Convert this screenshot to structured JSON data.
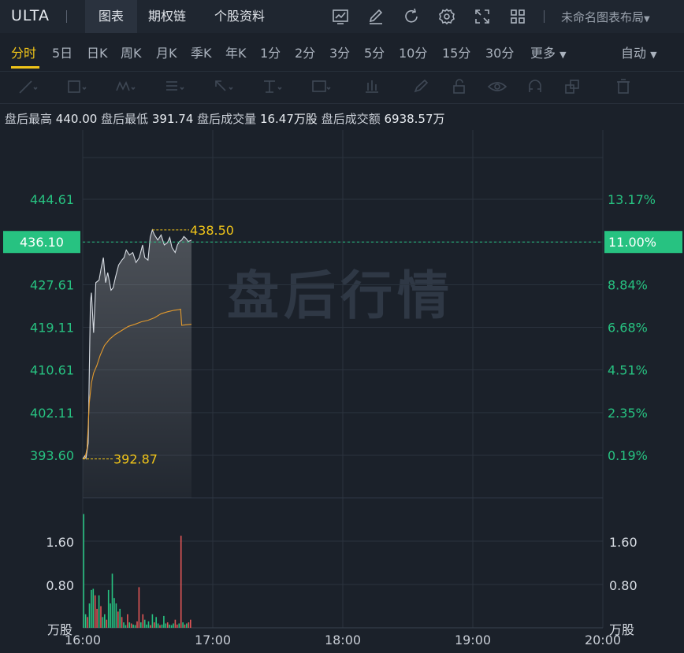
{
  "header": {
    "ticker": "ULTA",
    "tabs": [
      {
        "label": "图表",
        "active": true
      },
      {
        "label": "期权链",
        "active": false
      },
      {
        "label": "个股资料",
        "active": false
      }
    ],
    "layout_label": "未命名图表布局",
    "icons": [
      "chart-icon",
      "edit-icon",
      "refresh-icon",
      "settings-icon",
      "fullscreen-icon",
      "grid-icon"
    ]
  },
  "periods": [
    {
      "label": "分时",
      "active": true
    },
    {
      "label": "5日"
    },
    {
      "label": "日K"
    },
    {
      "label": "周K"
    },
    {
      "label": "月K"
    },
    {
      "label": "季K"
    },
    {
      "label": "年K"
    },
    {
      "label": "1分"
    },
    {
      "label": "2分"
    },
    {
      "label": "3分"
    },
    {
      "label": "5分"
    },
    {
      "label": "10分"
    },
    {
      "label": "15分"
    },
    {
      "label": "30分"
    },
    {
      "label": "更多"
    }
  ],
  "auto_label": "自动",
  "stats": {
    "high_label": "盘后最高",
    "high": "440.00",
    "low_label": "盘后最低",
    "low": "391.74",
    "vol_label": "盘后成交量",
    "vol": "16.47万股",
    "amt_label": "盘后成交额",
    "amt": "6938.57万"
  },
  "watermark": "盘后行情",
  "colors": {
    "up": "#27c281",
    "down": "#e05555",
    "accent": "#f0c419",
    "price_line": "#d8dde4",
    "avg_line": "#e39a2d"
  },
  "chart_data": {
    "type": "line",
    "x_ticks": [
      "16:00",
      "17:00",
      "18:00",
      "19:00",
      "20:00"
    ],
    "price_ticks": [
      "444.61",
      "436.10",
      "427.61",
      "419.11",
      "410.61",
      "402.11",
      "393.60"
    ],
    "pct_ticks": [
      "13.17%",
      "11.00%",
      "8.84%",
      "6.68%",
      "4.51%",
      "2.35%",
      "0.19%"
    ],
    "ylim": [
      388,
      452
    ],
    "current_price": "436.10",
    "current_pct": "11.00%",
    "max_label": "438.50",
    "min_label": "392.87",
    "price": [
      [
        0.0,
        392.9
      ],
      [
        0.02,
        393.5
      ],
      [
        0.03,
        393.0
      ],
      [
        0.05,
        396.0
      ],
      [
        0.07,
        424.0
      ],
      [
        0.08,
        426.0
      ],
      [
        0.1,
        418.0
      ],
      [
        0.12,
        428.0
      ],
      [
        0.15,
        428.5
      ],
      [
        0.17,
        431.0
      ],
      [
        0.19,
        433.0
      ],
      [
        0.21,
        428.0
      ],
      [
        0.23,
        430.0
      ],
      [
        0.26,
        426.5
      ],
      [
        0.28,
        427.0
      ],
      [
        0.3,
        429.0
      ],
      [
        0.33,
        431.5
      ],
      [
        0.36,
        432.5
      ],
      [
        0.38,
        433.0
      ],
      [
        0.4,
        434.5
      ],
      [
        0.43,
        433.5
      ],
      [
        0.46,
        434.0
      ],
      [
        0.49,
        432.0
      ],
      [
        0.52,
        433.0
      ],
      [
        0.55,
        435.5
      ],
      [
        0.57,
        433.0
      ],
      [
        0.6,
        432.5
      ],
      [
        0.62,
        437.0
      ],
      [
        0.64,
        438.5
      ],
      [
        0.66,
        437.5
      ],
      [
        0.69,
        436.5
      ],
      [
        0.72,
        437.5
      ],
      [
        0.75,
        435.5
      ],
      [
        0.78,
        436.0
      ],
      [
        0.8,
        437.0
      ],
      [
        0.82,
        435.0
      ],
      [
        0.85,
        434.0
      ],
      [
        0.87,
        435.5
      ],
      [
        0.89,
        436.2
      ],
      [
        0.91,
        436.5
      ],
      [
        0.93,
        437.2
      ],
      [
        0.95,
        436.8
      ],
      [
        0.97,
        436.2
      ],
      [
        1.0,
        436.5
      ]
    ],
    "avg": [
      [
        0.0,
        392.9
      ],
      [
        0.02,
        393.0
      ],
      [
        0.04,
        395.0
      ],
      [
        0.06,
        404.0
      ],
      [
        0.08,
        408.0
      ],
      [
        0.1,
        410.0
      ],
      [
        0.13,
        411.5
      ],
      [
        0.16,
        413.5
      ],
      [
        0.2,
        415.5
      ],
      [
        0.25,
        416.8
      ],
      [
        0.3,
        417.7
      ],
      [
        0.36,
        418.5
      ],
      [
        0.42,
        419.3
      ],
      [
        0.48,
        419.7
      ],
      [
        0.54,
        420.2
      ],
      [
        0.6,
        420.5
      ],
      [
        0.66,
        421.0
      ],
      [
        0.72,
        421.8
      ],
      [
        0.78,
        422.2
      ],
      [
        0.84,
        422.5
      ],
      [
        0.88,
        422.6
      ],
      [
        0.9,
        422.7
      ],
      [
        0.91,
        419.5
      ],
      [
        0.95,
        419.6
      ],
      [
        1.0,
        419.7
      ]
    ],
    "volume_ylabel": "万股",
    "volume_ticks": [
      "1.60",
      "0.80"
    ],
    "volume_ylim": [
      0,
      2.4
    ],
    "volume": [
      {
        "v": 2.1,
        "up": true
      },
      {
        "v": 0.25,
        "up": true
      },
      {
        "v": 0.2,
        "up": false
      },
      {
        "v": 0.45,
        "up": true
      },
      {
        "v": 0.7,
        "up": true
      },
      {
        "v": 0.72,
        "up": true
      },
      {
        "v": 0.6,
        "up": false
      },
      {
        "v": 0.35,
        "up": false
      },
      {
        "v": 0.6,
        "up": true
      },
      {
        "v": 0.4,
        "up": false
      },
      {
        "v": 0.2,
        "up": true
      },
      {
        "v": 0.25,
        "up": true
      },
      {
        "v": 0.15,
        "up": false
      },
      {
        "v": 0.7,
        "up": true
      },
      {
        "v": 0.45,
        "up": true
      },
      {
        "v": 1.0,
        "up": true
      },
      {
        "v": 0.55,
        "up": true
      },
      {
        "v": 0.45,
        "up": true
      },
      {
        "v": 0.3,
        "up": false
      },
      {
        "v": 0.35,
        "up": true
      },
      {
        "v": 0.2,
        "up": false
      },
      {
        "v": 0.1,
        "up": true
      },
      {
        "v": 0.05,
        "up": true
      },
      {
        "v": 0.25,
        "up": false
      },
      {
        "v": 0.1,
        "up": true
      },
      {
        "v": 0.08,
        "up": false
      },
      {
        "v": 0.06,
        "up": true
      },
      {
        "v": 0.05,
        "up": true
      },
      {
        "v": 0.12,
        "up": false
      },
      {
        "v": 0.75,
        "up": false
      },
      {
        "v": 0.1,
        "up": true
      },
      {
        "v": 0.25,
        "up": false
      },
      {
        "v": 0.15,
        "up": true
      },
      {
        "v": 0.06,
        "up": true
      },
      {
        "v": 0.12,
        "up": true
      },
      {
        "v": 0.05,
        "up": false
      },
      {
        "v": 0.25,
        "up": true
      },
      {
        "v": 0.1,
        "up": false
      },
      {
        "v": 0.2,
        "up": true
      },
      {
        "v": 0.08,
        "up": true
      },
      {
        "v": 0.05,
        "up": false
      },
      {
        "v": 0.06,
        "up": true
      },
      {
        "v": 0.22,
        "up": true
      },
      {
        "v": 0.08,
        "up": true
      },
      {
        "v": 0.1,
        "up": false
      },
      {
        "v": 0.06,
        "up": true
      },
      {
        "v": 0.05,
        "up": true
      },
      {
        "v": 0.08,
        "up": true
      },
      {
        "v": 0.15,
        "up": false
      },
      {
        "v": 0.06,
        "up": false
      },
      {
        "v": 0.08,
        "up": true
      },
      {
        "v": 1.7,
        "up": false
      },
      {
        "v": 0.1,
        "up": true
      },
      {
        "v": 0.06,
        "up": false
      },
      {
        "v": 0.08,
        "up": true
      },
      {
        "v": 0.1,
        "up": false
      },
      {
        "v": 0.15,
        "up": false
      }
    ]
  }
}
